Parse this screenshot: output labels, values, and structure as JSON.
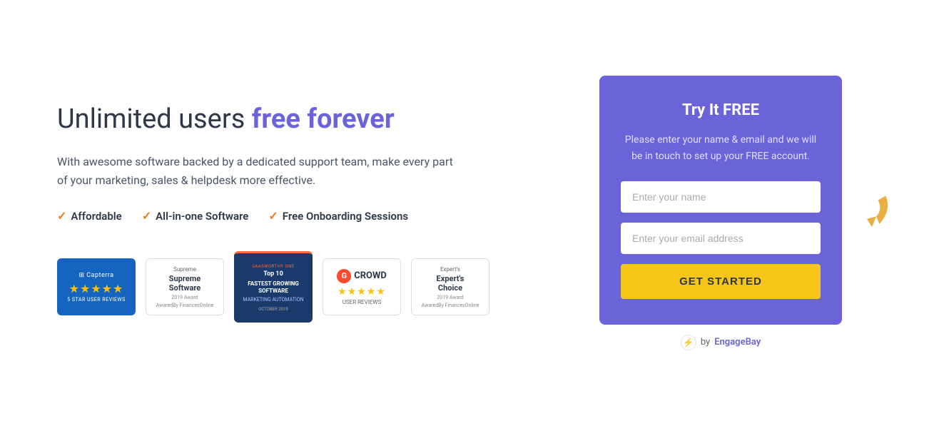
{
  "heading": {
    "prefix": "Unlimited users ",
    "highlight": "free forever"
  },
  "description": "With awesome software backed by a dedicated support team, make every part of your marketing, sales & helpdesk more effective.",
  "features": [
    {
      "label": "Affordable"
    },
    {
      "label": "All-in-one Software"
    },
    {
      "label": "Free Onboarding Sessions"
    }
  ],
  "badges": [
    {
      "type": "capterra",
      "title": "Capterra",
      "stars": "★★★★★",
      "sub": "5 STAR USER REVIEWS"
    },
    {
      "type": "supreme",
      "top": "Supreme",
      "main": "Supreme Software",
      "sub": "2019 Award",
      "sub2": "AwaredBy FinancesOnline"
    },
    {
      "type": "saasworthy",
      "top": "SaasWorthy ONE",
      "rank": "Top 10",
      "category": "FASTEST GROWING SOFTWARE",
      "sub": "MARKETING AUTOMATION",
      "date": "OCTOBER 2019"
    },
    {
      "type": "gcrowd",
      "stars": "★★★★★",
      "sub": "USER REVIEWS"
    },
    {
      "type": "experts",
      "top": "Expert's",
      "main": "Expert's Choice",
      "sub": "2019 Award",
      "sub2": "AwaredBy FinancesOnline"
    }
  ],
  "form": {
    "title": "Try It FREE",
    "description": "Please enter your name & email and we will be in touch to set up your FREE account.",
    "name_placeholder": "Enter your name",
    "email_placeholder": "Enter your email address",
    "button_label": "GET STARTED"
  },
  "powered_by": {
    "prefix": "by ",
    "brand": "EngageBay"
  }
}
